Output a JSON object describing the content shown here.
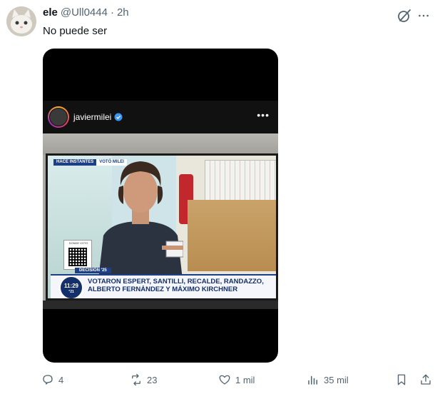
{
  "tweet": {
    "display_name": "ele",
    "handle": "@Ull0444",
    "separator": "·",
    "time": "2h",
    "text": "No puede ser"
  },
  "media": {
    "instagram": {
      "username": "javiermilei",
      "more": "•••"
    },
    "tv": {
      "top_tag_1": "HACE INSTANTES",
      "top_tag_2": "VOTÓ MILEI",
      "qr_label": "DONDE VOTO",
      "decision": "DECISIÓN '25",
      "clock": "11:29",
      "clock_sub": "°21",
      "headline_line1": "VOTARON ESPERT, SANTILLI, RECALDE, RANDAZZO,",
      "headline_line2": "ALBERTO FERNÁNDEZ Y MÁXIMO KIRCHNER"
    }
  },
  "actions": {
    "replies": "4",
    "reposts": "23",
    "likes": "1 mil",
    "views": "35 mil"
  },
  "colors": {
    "text_primary": "#0f1419",
    "text_secondary": "#536471",
    "tv_blue": "#1d3f88"
  }
}
